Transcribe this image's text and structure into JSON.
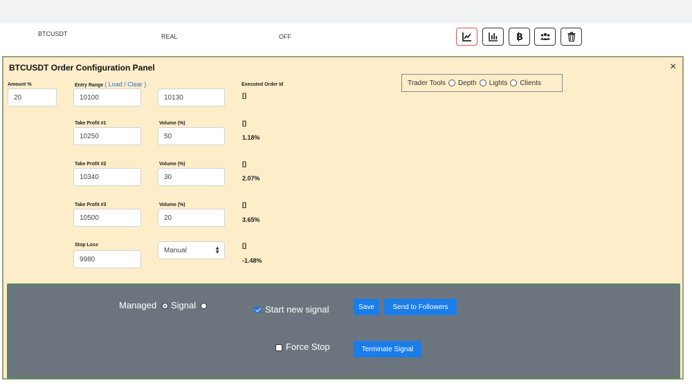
{
  "row": {
    "symbol": "BTCUSDT",
    "mode": "REAL",
    "status": "OFF",
    "tools": [
      {
        "name": "line-chart-icon"
      },
      {
        "name": "bar-chart-icon"
      },
      {
        "name": "bitcoin-icon"
      },
      {
        "name": "users-icon"
      },
      {
        "name": "trash-icon"
      }
    ]
  },
  "panel": {
    "title": "BTCUSDT Order Configuration Panel",
    "close": "×",
    "amount": {
      "label": "Amount %",
      "value": "20"
    },
    "entry_range": {
      "label": "Entry Range",
      "link": "( Load / Clear )",
      "low": "10100",
      "high": "10130"
    },
    "executed_label": "Executed Order Id",
    "entry_executed": "[]",
    "take_profits": [
      {
        "label": "Take Profit #1",
        "value": "10250",
        "volume_label": "Volume (%)",
        "volume": "50",
        "ids": "[]",
        "pct": "1.18%"
      },
      {
        "label": "Take Profit #2",
        "value": "10340",
        "volume_label": "Volume (%)",
        "volume": "30",
        "ids": "[]",
        "pct": "2.07%"
      },
      {
        "label": "Take Profit #3",
        "value": "10500",
        "volume_label": "Volume (%)",
        "volume": "20",
        "ids": "[]",
        "pct": "3.65%"
      }
    ],
    "stop_loss": {
      "label": "Stop Loss",
      "value": "9980",
      "mode": "Manual",
      "ids": "[]",
      "pct": "-1.48%"
    },
    "trader_tools": {
      "label": "Trader Tools",
      "options": [
        "Depth",
        "Lights",
        "Clients"
      ]
    }
  },
  "controls": {
    "managed_label": "Managed",
    "signal_label": "Signal",
    "start_new_signal": "Start new signal",
    "save": "Save",
    "send_to_followers": "Send to Followers",
    "force_stop": "Force Stop",
    "terminate_signal": "Terminate Signal"
  },
  "colors": {
    "accent": "#1a7de8",
    "panel_bg": "#fdedc9",
    "dark_bg": "#6c757d"
  }
}
